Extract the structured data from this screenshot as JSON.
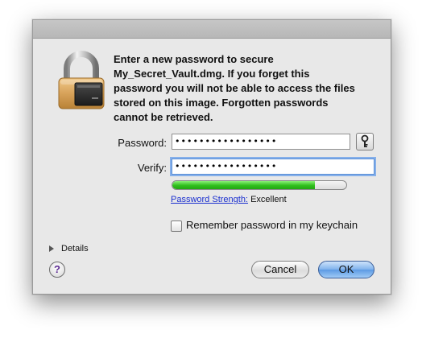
{
  "dialog": {
    "message": "Enter a new password to secure\nMy_Secret_Vault.dmg.  If you forget this\npassword you will not be able to access the files\nstored on this image. Forgotten passwords\ncannot be retrieved.",
    "icon": "padlock-icon"
  },
  "password": {
    "label": "Password:",
    "value": "•••••••••••••••••"
  },
  "verify": {
    "label": "Verify:",
    "value": "•••••••••••••••••"
  },
  "strength": {
    "link_label": "Password Strength:",
    "value_label": "Excellent",
    "fill_fraction": 0.82,
    "color": "#2fbf1c"
  },
  "keychain": {
    "label": "Remember password in my keychain",
    "checked": false
  },
  "details": {
    "label": "Details"
  },
  "buttons": {
    "help": "?",
    "cancel": "Cancel",
    "ok": "OK"
  },
  "colors": {
    "default_button": "#5c9ae3",
    "focus_ring": "#86b0ea",
    "link": "#1a2fcf"
  }
}
